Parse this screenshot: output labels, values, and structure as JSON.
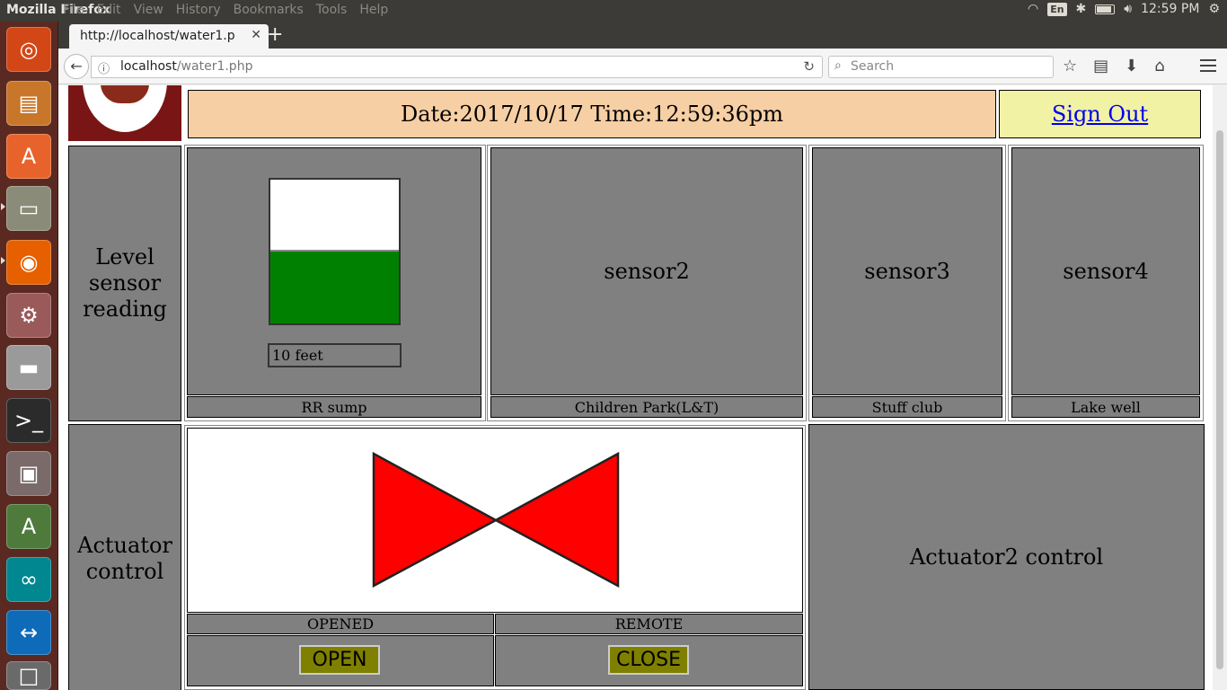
{
  "topbar": {
    "app_title": "Mozilla Firefox",
    "menu": [
      "File",
      "Edit",
      "View",
      "History",
      "Bookmarks",
      "Tools",
      "Help"
    ],
    "keyboard_layout": "En",
    "clock": "12:59 PM"
  },
  "browser": {
    "tab_title": "http://localhost/water1.p",
    "url_host": "localhost",
    "url_path": "/water1.php",
    "search_placeholder": "Search"
  },
  "header": {
    "datetime": "Date:2017/10/17 Time:12:59:36pm",
    "sign_out": "Sign Out"
  },
  "level_row": {
    "row_label": "Level sensor reading",
    "sensors": [
      {
        "name": "",
        "location": "RR sump",
        "reading": "10 feet",
        "fill_fraction": 0.5
      },
      {
        "name": "sensor2",
        "location": "Children Park(L&T)"
      },
      {
        "name": "sensor3",
        "location": "Stuff club"
      },
      {
        "name": "sensor4",
        "location": "Lake well"
      }
    ]
  },
  "actuator_row": {
    "row_label": "Actuator control",
    "valve_color": "#ff0000",
    "status": "OPENED",
    "mode": "REMOTE",
    "open_label": "OPEN",
    "close_label": "CLOSE",
    "actuator2_label": "Actuator2 control"
  },
  "colors": {
    "panel_grey": "#808080",
    "tank_fill": "#008000",
    "date_bg": "#f7cfa4",
    "signout_bg": "#f2f2a5",
    "button_bg": "#808000"
  }
}
